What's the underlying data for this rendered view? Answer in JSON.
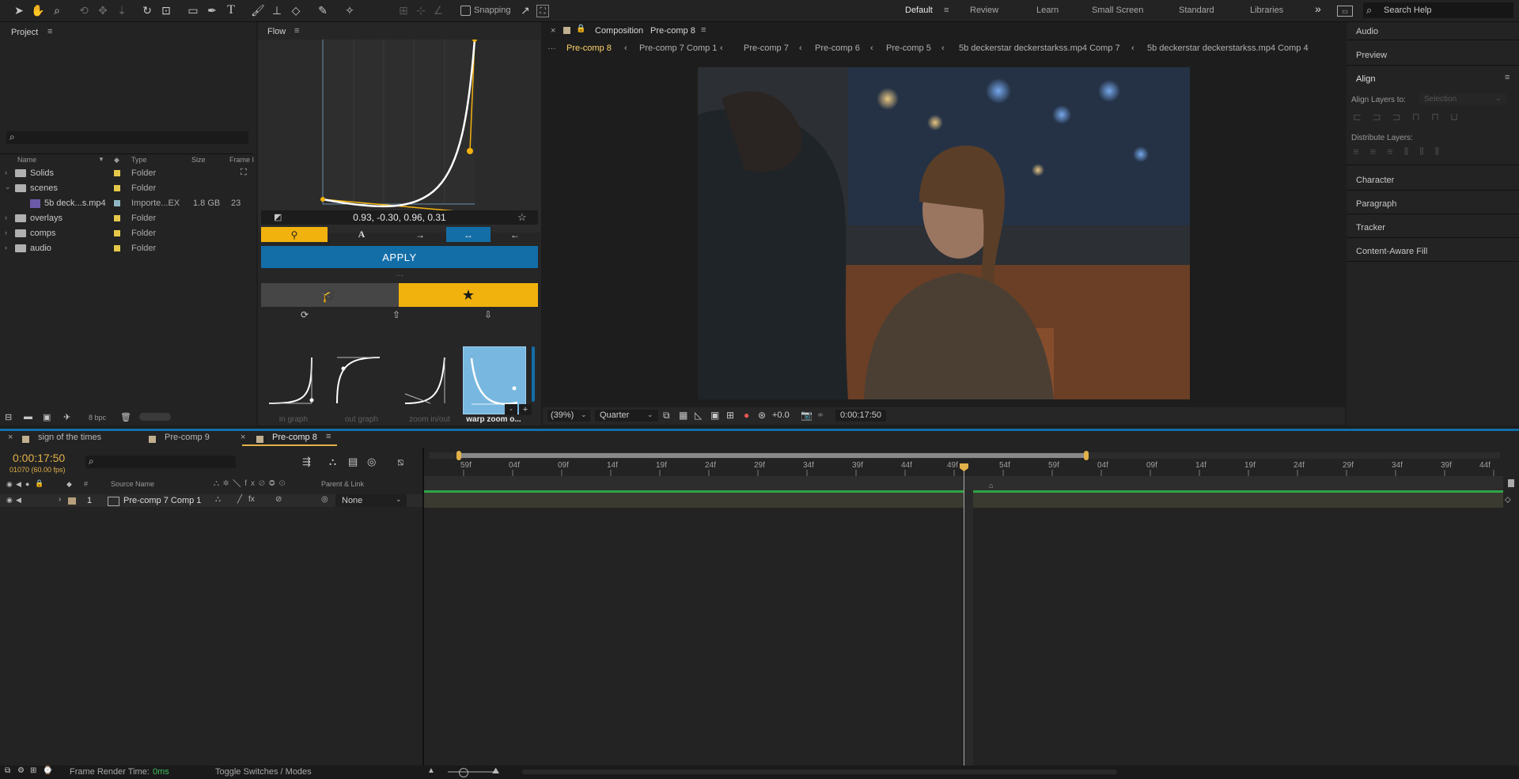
{
  "toolbar": {
    "snapping_label": "Snapping",
    "workspaces": [
      "Default",
      "Review",
      "Learn",
      "Small Screen",
      "Standard",
      "Libraries"
    ],
    "search_placeholder": "Search Help",
    "overflow_glyph": "»"
  },
  "project": {
    "title": "Project",
    "columns": {
      "name": "Name",
      "type": "Type",
      "size": "Size",
      "frame": "Frame I"
    },
    "items": [
      {
        "name": "Solids",
        "type": "Folder",
        "size": "",
        "frame": ""
      },
      {
        "name": "scenes",
        "type": "Folder",
        "size": "",
        "frame": ""
      },
      {
        "name": "5b deck...s.mp4",
        "type": "Importe...EX",
        "size": "1.8 GB",
        "frame": "23"
      },
      {
        "name": "overlays",
        "type": "Folder",
        "size": "",
        "frame": ""
      },
      {
        "name": "comps",
        "type": "Folder",
        "size": "",
        "frame": ""
      },
      {
        "name": "audio",
        "type": "Folder",
        "size": "",
        "frame": ""
      }
    ],
    "bpc_label": "8 bpc"
  },
  "flow": {
    "title": "Flow",
    "curve_values": "0.93, -0.30, 0.96, 0.31",
    "apply_label": "APPLY",
    "presets": [
      {
        "label": "in graph"
      },
      {
        "label": "out graph"
      },
      {
        "label": "zoom in/out"
      },
      {
        "label": "warp zoom o..."
      }
    ],
    "curve": {
      "p1": [
        0.93,
        -0.3
      ],
      "p2": [
        0.96,
        0.31
      ]
    }
  },
  "viewer": {
    "composition_label": "Composition",
    "composition_name": "Pre-comp 8",
    "breadcrumbs": [
      "Pre-comp 8",
      "Pre-comp 7 Comp 1",
      "Pre-comp 7",
      "Pre-comp 6",
      "Pre-comp 5",
      "5b deckerstar deckerstarkss.mp4 Comp 7",
      "5b deckerstar deckerstarkss.mp4 Comp 4"
    ],
    "zoom": "(39%)",
    "resolution": "Quarter",
    "exposure": "+0.0",
    "timecode": "0:00:17:50"
  },
  "right_panel": {
    "items_top": [
      "Audio",
      "Preview"
    ],
    "align": {
      "title": "Align",
      "align_layers_label": "Align Layers to:",
      "align_layers_value": "Selection",
      "distribute_label": "Distribute Layers:"
    },
    "items_bottom": [
      "Character",
      "Paragraph",
      "Tracker",
      "Content-Aware Fill"
    ]
  },
  "timeline": {
    "tabs": [
      "sign of the times",
      "Pre-comp 9",
      "Pre-comp 8"
    ],
    "timecode": "0:00:17:50",
    "frame_info": "01070 (60.00 fps)",
    "columns": {
      "source_name": "Source Name",
      "parent_link": "Parent & Link",
      "number": "#"
    },
    "layer": {
      "number": "1",
      "name": "Pre-comp 7 Comp 1",
      "parent": "None"
    },
    "ticks": [
      "59f",
      "04f",
      "09f",
      "14f",
      "19f",
      "24f",
      "29f",
      "34f",
      "39f",
      "44f",
      "49f",
      "54f",
      "59f",
      "04f",
      "09f",
      "14f",
      "19f",
      "24f",
      "29f",
      "34f",
      "39f",
      "44f"
    ]
  },
  "status": {
    "render_label": "Frame Render Time:",
    "render_value": "0ms",
    "toggle_label": "Toggle Switches / Modes"
  },
  "colors": {
    "accent_blue": "#136ea8",
    "flow_yellow": "#f2b20e",
    "label_yellow": "#e6c84a",
    "timecode_orange": "#e2b14a",
    "layer_bar": "#3a3a30",
    "render_green": "#3fbf5f"
  }
}
